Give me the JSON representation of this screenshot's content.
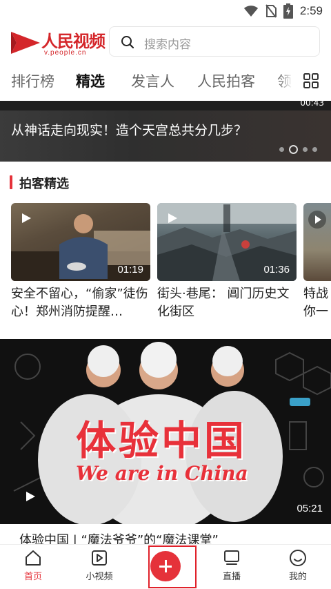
{
  "status_bar": {
    "time": "2:59",
    "icons": [
      "wifi-icon",
      "no-sim-icon",
      "battery-charging-icon"
    ]
  },
  "header": {
    "logo_text": "人民视频",
    "logo_sub": "v.people.cn",
    "search_placeholder": "搜索内容"
  },
  "tabs": [
    {
      "label": "排行榜",
      "active": false
    },
    {
      "label": "精选",
      "active": true
    },
    {
      "label": "发言人",
      "active": false
    },
    {
      "label": "人民拍客",
      "active": false
    },
    {
      "label": "领导",
      "active": false
    }
  ],
  "banner": {
    "title": "从神话走向现实！造个天宫总共分几步？",
    "top_duration": "00:43",
    "slide_count": 4,
    "active_slide": 2
  },
  "section": {
    "title": "拍客精选"
  },
  "cards": [
    {
      "title": "安全不留心，“偷家”徒伤心！郑州消防提醒…",
      "duration": "01:19"
    },
    {
      "title": "街头·巷尾： 阊门历史文化街区",
      "duration": "01:36"
    },
    {
      "title": "特战你一",
      "duration": ""
    }
  ],
  "big_video": {
    "title_cn": "体验中国",
    "title_en": "We are in China",
    "duration": "05:21",
    "caption": "体验中国 | “魔法爷爷”的“魔法课堂”"
  },
  "bottom_nav": [
    {
      "label": "首页",
      "icon": "home-icon",
      "active": true
    },
    {
      "label": "小视频",
      "icon": "short-video-icon",
      "active": false
    },
    {
      "label": "",
      "icon": "add-icon",
      "active": false
    },
    {
      "label": "直播",
      "icon": "live-tv-icon",
      "active": false
    },
    {
      "label": "我的",
      "icon": "profile-smile-icon",
      "active": false
    }
  ],
  "colors": {
    "brand_red": "#e5323a",
    "logo_red": "#d4262a"
  }
}
